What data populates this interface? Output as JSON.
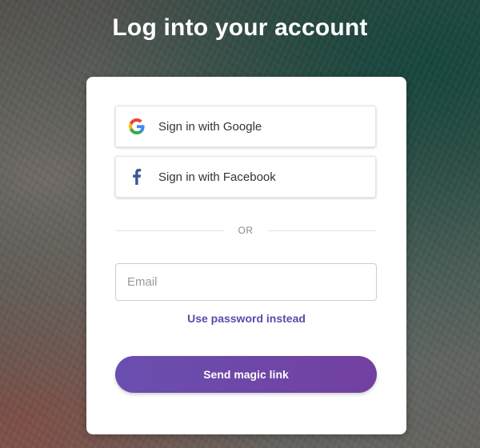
{
  "page": {
    "title": "Log into your account"
  },
  "social": {
    "google_label": "Sign in with Google",
    "google_icon": "google-g-icon",
    "facebook_label": "Sign in with Facebook",
    "facebook_icon": "facebook-f-icon",
    "facebook_color": "#3b5998"
  },
  "divider": {
    "text": "OR"
  },
  "form": {
    "email_placeholder": "Email",
    "email_value": "",
    "password_link": "Use password instead",
    "submit_label": "Send magic link"
  },
  "colors": {
    "accent": "#6a4fb0",
    "link": "#5a4aa8"
  }
}
